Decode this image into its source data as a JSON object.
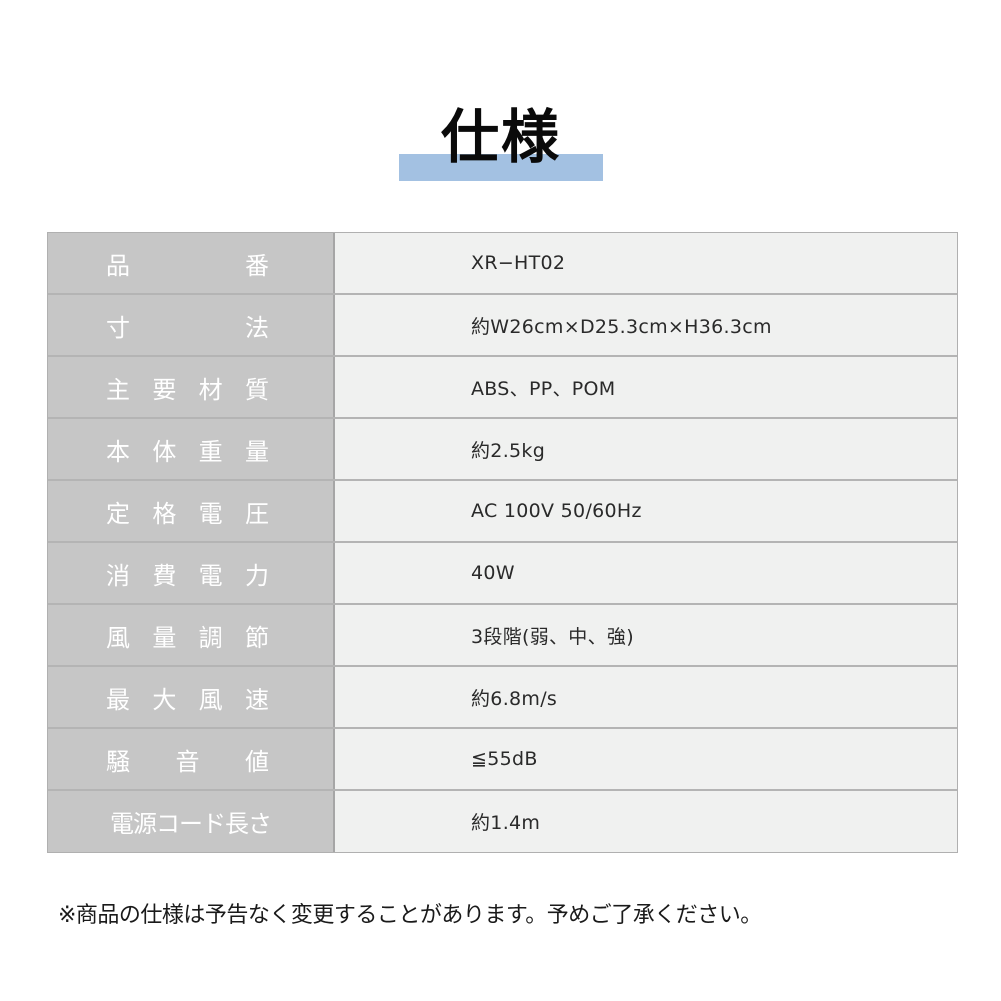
{
  "title": "仕様",
  "colors": {
    "title_bar": "#a3c1e2",
    "label_bg": "#c6c6c6",
    "value_bg": "#f0f1f0"
  },
  "specs": [
    {
      "label_chars": [
        "品",
        "番"
      ],
      "value": "XR−HT02"
    },
    {
      "label_chars": [
        "寸",
        "法"
      ],
      "value": "約W26cm×D25.3cm×H36.3cm"
    },
    {
      "label_chars": [
        "主",
        "要",
        "材",
        "質"
      ],
      "value": "ABS、PP、POM"
    },
    {
      "label_chars": [
        "本",
        "体",
        "重",
        "量"
      ],
      "value": "約2.5kg"
    },
    {
      "label_chars": [
        "定",
        "格",
        "電",
        "圧"
      ],
      "value": "AC 100V  50/60Hz"
    },
    {
      "label_chars": [
        "消",
        "費",
        "電",
        "力"
      ],
      "value": "40W"
    },
    {
      "label_chars": [
        "風",
        "量",
        "調",
        "節"
      ],
      "value": "3段階(弱、中、強)"
    },
    {
      "label_chars": [
        "最",
        "大",
        "風",
        "速"
      ],
      "value": "約6.8m/s"
    },
    {
      "label_chars": [
        "騒",
        "音",
        "値"
      ],
      "value": "≦55dB"
    },
    {
      "label": "電源コード長さ",
      "value": "約1.4m"
    }
  ],
  "note": "※商品の仕様は予告なく変更することがあります。予めご了承ください。"
}
